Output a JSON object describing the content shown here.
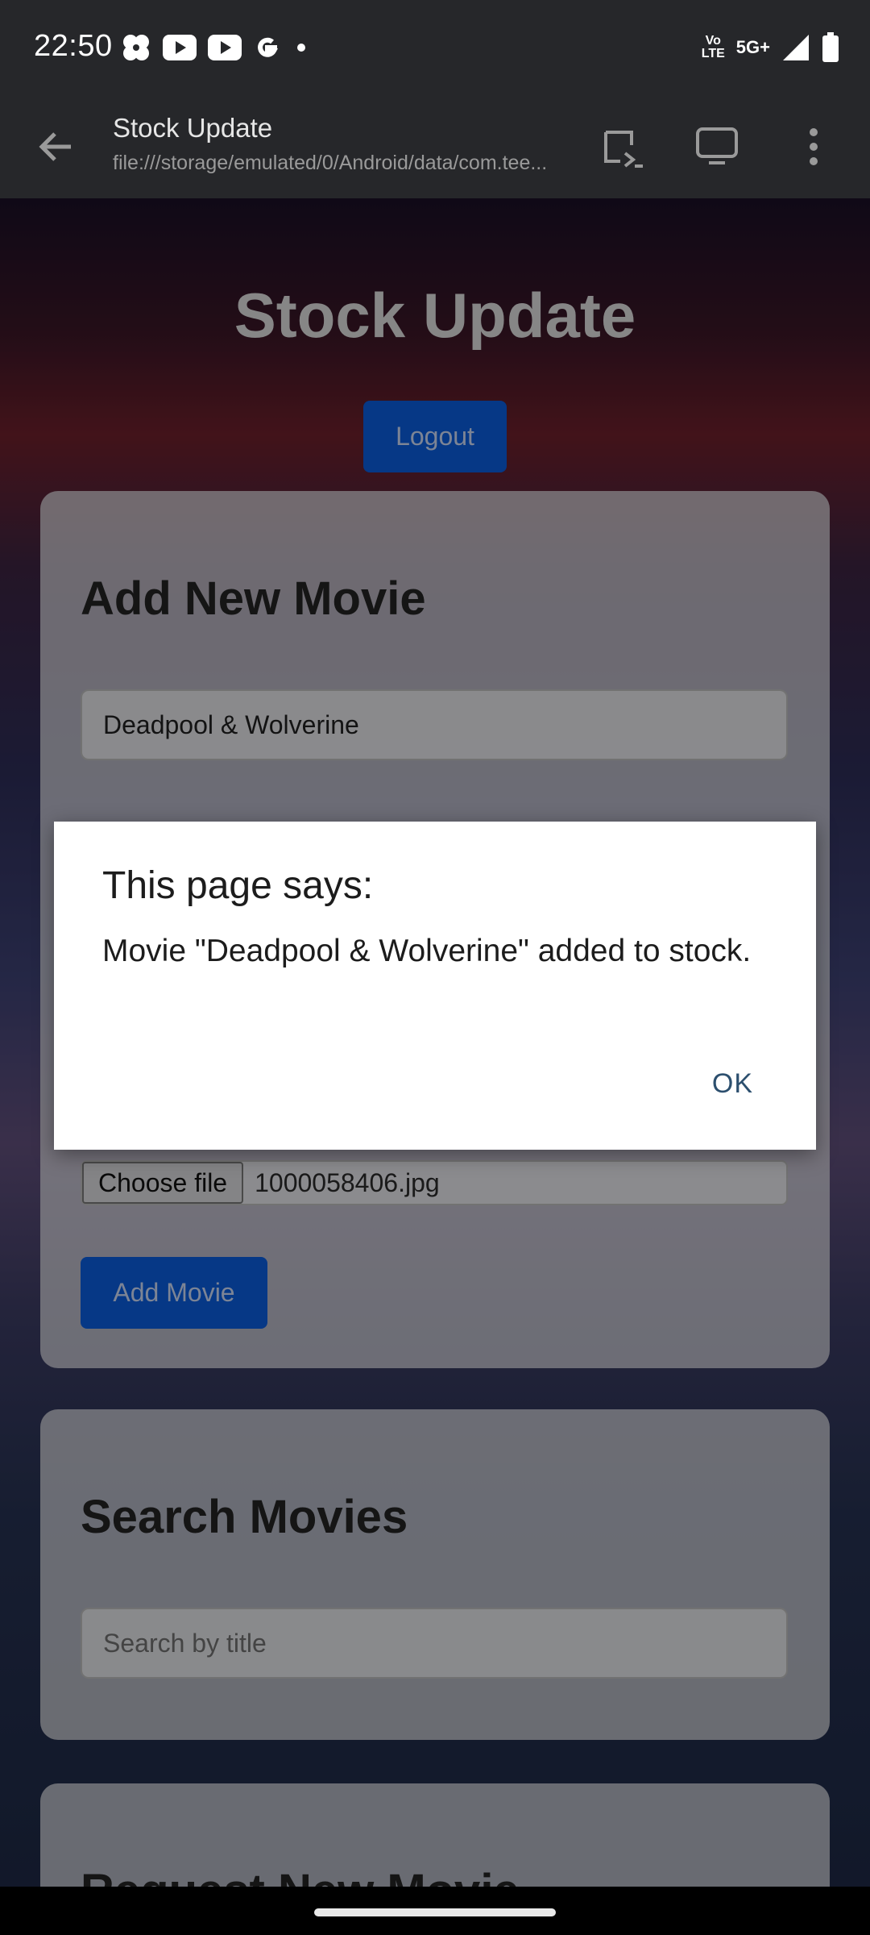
{
  "status_bar": {
    "time": "22:50",
    "notification_icons": [
      "pinwheel-icon",
      "youtube-icon",
      "youtube-icon",
      "google-icon",
      "dot-icon"
    ],
    "volte_top": "Vo",
    "volte_bottom": "LTE",
    "network": "5G+"
  },
  "toolbar": {
    "title": "Stock Update",
    "url": "file:///storage/emulated/0/Android/data/com.tee..."
  },
  "page": {
    "title": "Stock Update",
    "logout_label": "Logout",
    "add_movie_card": {
      "heading": "Add New Movie",
      "title_value": "Deadpool & Wolverine",
      "choose_file_label": "Choose file",
      "file_name": "1000058406.jpg",
      "add_button_label": "Add Movie"
    },
    "search_card": {
      "heading": "Search Movies",
      "search_placeholder": "Search by title"
    },
    "request_card": {
      "heading": "Request New Movie"
    }
  },
  "dialog": {
    "title": "This page says:",
    "message": "Movie \"Deadpool & Wolverine\" added to stock.",
    "ok_label": "OK"
  },
  "colors": {
    "accent_button": "#0a5bd9",
    "dialog_ok": "#2c4f6e"
  }
}
